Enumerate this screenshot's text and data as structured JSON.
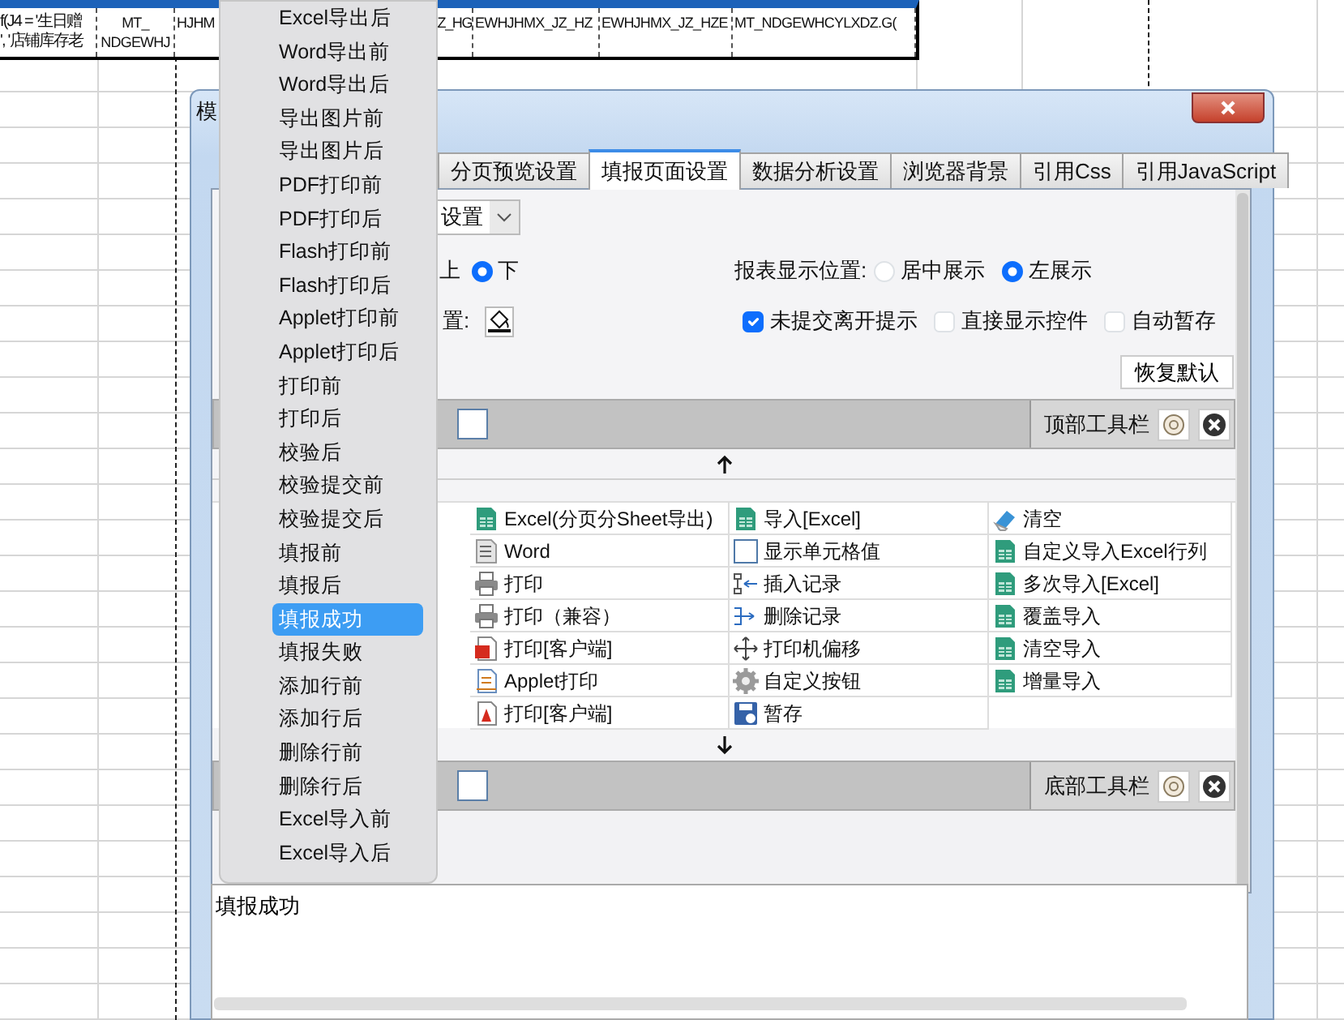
{
  "sheet": {
    "cells": [
      {
        "lines": [
          "f(J4 = '生日赠",
          "', '店铺库存老"
        ]
      },
      {
        "lines": [
          "MT_",
          "NDGEWHJ"
        ]
      },
      {
        "lines": [
          "HJHM"
        ]
      },
      {
        "lines": [
          "Z_HG"
        ]
      },
      {
        "lines": [
          "EWHJHMX_JZ_HZ"
        ]
      },
      {
        "lines": [
          "EWHJHMX_JZ_HZE"
        ]
      },
      {
        "lines": [
          "MT_NDGEWHCYLXDZ.G("
        ]
      }
    ]
  },
  "dialog": {
    "title": "模",
    "tabs": [
      {
        "label": "分页预览设置",
        "selected": false
      },
      {
        "label": "填报页面设置",
        "selected": true
      },
      {
        "label": "数据分析设置",
        "selected": false
      },
      {
        "label": "浏览器背景",
        "selected": false
      },
      {
        "label": "引用Css",
        "selected": false
      },
      {
        "label": "引用JavaScript",
        "selected": false
      }
    ],
    "mode_dropdown": {
      "value": "设置"
    },
    "toolbar_position": {
      "options": [
        {
          "label": "上"
        },
        {
          "label": "下",
          "selected": true
        }
      ]
    },
    "report_position": {
      "label": "报表显示位置:",
      "options": [
        {
          "label": "居中展示",
          "selected": false
        },
        {
          "label": "左展示",
          "selected": true
        }
      ]
    },
    "background_setting": {
      "label": "置:"
    },
    "checkboxes": [
      {
        "label": "未提交离开提示",
        "checked": true
      },
      {
        "label": "直接显示控件",
        "checked": false
      },
      {
        "label": "自动暂存",
        "checked": false
      }
    ],
    "restore_button": "恢复默认",
    "top_toolbar": {
      "label": "顶部工具栏"
    },
    "buttons": [
      {
        "label": "Excel(分页分Sheet导出)",
        "kind": "excel"
      },
      {
        "label": "导入[Excel]",
        "kind": "excel"
      },
      {
        "label": "清空",
        "kind": "eraser"
      },
      {
        "label": "Word",
        "kind": "word"
      },
      {
        "label": "显示单元格值",
        "kind": "cell"
      },
      {
        "label": "自定义导入Excel行列",
        "kind": "excel"
      },
      {
        "label": "打印",
        "kind": "printer"
      },
      {
        "label": "插入记录",
        "kind": "insert"
      },
      {
        "label": "多次导入[Excel]",
        "kind": "excel"
      },
      {
        "label": "打印（兼容）",
        "kind": "printer"
      },
      {
        "label": "删除记录",
        "kind": "delete"
      },
      {
        "label": "覆盖导入",
        "kind": "excel"
      },
      {
        "label": "打印[客户端]",
        "kind": "flash"
      },
      {
        "label": "打印机偏移",
        "kind": "move"
      },
      {
        "label": "清空导入",
        "kind": "excel"
      },
      {
        "label": "Applet打印",
        "kind": "applet"
      },
      {
        "label": "自定义按钮",
        "kind": "gear"
      },
      {
        "label": "增量导入",
        "kind": "excel"
      },
      {
        "label": "打印[客户端]",
        "kind": "pdf"
      },
      {
        "label": "暂存",
        "kind": "save"
      }
    ],
    "bottom_toolbar": {
      "label": "底部工具栏"
    },
    "event_script": "填报成功"
  },
  "event_menu": {
    "items": [
      {
        "label": "Excel导出后",
        "selected": false
      },
      {
        "label": "Word导出前",
        "selected": false
      },
      {
        "label": "Word导出后",
        "selected": false
      },
      {
        "label": "导出图片前",
        "selected": false
      },
      {
        "label": "导出图片后",
        "selected": false
      },
      {
        "label": "PDF打印前",
        "selected": false
      },
      {
        "label": "PDF打印后",
        "selected": false
      },
      {
        "label": "Flash打印前",
        "selected": false
      },
      {
        "label": "Flash打印后",
        "selected": false
      },
      {
        "label": "Applet打印前",
        "selected": false
      },
      {
        "label": "Applet打印后",
        "selected": false
      },
      {
        "label": "打印前",
        "selected": false
      },
      {
        "label": "打印后",
        "selected": false
      },
      {
        "label": "校验后",
        "selected": false
      },
      {
        "label": "校验提交前",
        "selected": false
      },
      {
        "label": "校验提交后",
        "selected": false
      },
      {
        "label": "填报前",
        "selected": false
      },
      {
        "label": "填报后",
        "selected": false
      },
      {
        "label": "填报成功",
        "selected": true
      },
      {
        "label": "填报失败",
        "selected": false
      },
      {
        "label": "添加行前",
        "selected": false
      },
      {
        "label": "添加行后",
        "selected": false
      },
      {
        "label": "删除行前",
        "selected": false
      },
      {
        "label": "删除行后",
        "selected": false
      },
      {
        "label": "Excel导入前",
        "selected": false
      },
      {
        "label": "Excel导入后",
        "selected": false
      }
    ]
  }
}
